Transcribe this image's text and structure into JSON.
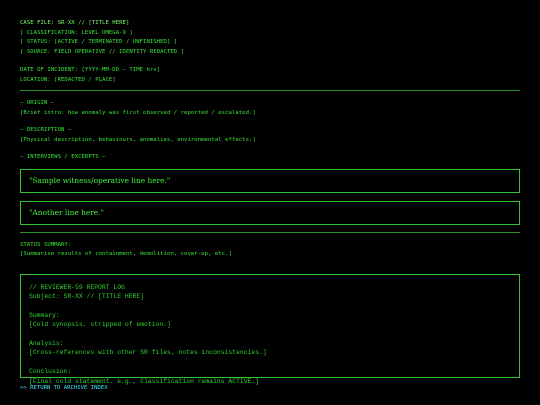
{
  "header": {
    "case_file": "CASE FILE: SR-XX // [TITLE HERE]",
    "classification": "[ CLASSIFICATION: LEVEL OMEGA-9 ]",
    "status": "[ STATUS: [ACTIVE / TERMINATED / UNFINISHED] ]",
    "source": "[ SOURCE: FIELD OPERATIVE // IDENTITY REDACTED ]",
    "date": "DATE OF INCIDENT: [YYYY-MM-DD – TIME hrs]",
    "location": "LOCATION: [REDACTED / PLACE]"
  },
  "origin": {
    "heading": "— ORIGIN —",
    "text": "[Brief intro: how anomaly was first observed / reported / escalated.]"
  },
  "description": {
    "heading": "— DESCRIPTION —",
    "text": "[Physical description, behaviours, anomalies, environmental effects.]"
  },
  "interviews": {
    "heading": "— INTERVIEWS / EXCERPTS —",
    "quotes": [
      "\"Sample witness/operative line here.\"",
      "\"Another line here.\""
    ]
  },
  "status_summary": {
    "heading": "STATUS SUMMARY:",
    "text": "[Summarise results of containment, demolition, cover-up, etc.]"
  },
  "log": {
    "title": "// REVIEWER-59 REPORT LOG",
    "subject": "Subject: SR-XX // [TITLE HERE]",
    "summary_label": "Summary:",
    "summary_text": "[Cold synopsis, stripped of emotion.]",
    "analysis_label": "Analysis:",
    "analysis_text": "[Cross-references with other SR files, notes inconsistencies.]",
    "conclusion_label": "Conclusion:",
    "conclusion_text": "[Final cold statement. e.g., Classification remains ACTIVE.]"
  },
  "footer": {
    "return_link": ">> RETURN TO ARCHIVE INDEX"
  },
  "colors": {
    "background": "#000000",
    "text": "#39e83a",
    "link": "#3fe7ff"
  }
}
